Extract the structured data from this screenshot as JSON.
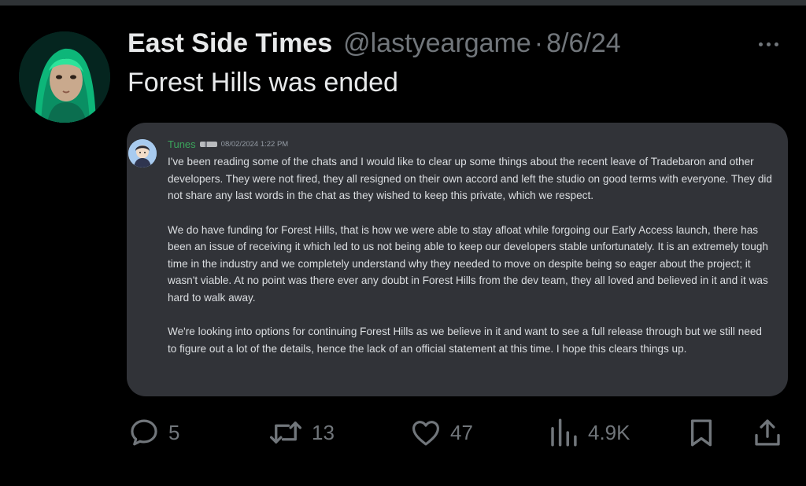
{
  "tweet": {
    "display_name": "East Side Times",
    "handle": "@lastyeargame",
    "separator": "·",
    "date": "8/6/24",
    "text": "Forest Hills was ended"
  },
  "message": {
    "author": "Tunes",
    "timestamp": "08/02/2024 1:22 PM",
    "paragraphs": [
      "I've been reading some of the chats and I would like to clear up some things about the recent leave of Tradebaron and other developers. They were not fired, they all resigned on their own accord and left the studio on good terms with everyone. They did not share any last words in the chat as they wished to keep this private, which we respect.",
      "We do have funding for Forest Hills, that is how we were able to stay afloat while forgoing our Early Access launch, there has been an issue of receiving it which led to us not being able to keep our developers stable unfortunately. It is an extremely tough time in the industry and we completely understand why they needed to move on despite being so eager about the project; it wasn't viable. At no point was there ever any doubt in Forest Hills from the dev team, they all loved and believed in it and it was hard to walk away.",
      "We're looking into options for continuing Forest Hills as we believe in it and want to see a full release through but we still need to figure out a lot of the details, hence the lack of an official statement at this time. I hope this clears things up."
    ]
  },
  "actions": {
    "replies": "5",
    "reposts": "13",
    "likes": "47",
    "views": "4.9K"
  },
  "icons": {
    "reply": "comment-bubble-icon",
    "repost": "repost-arrows-icon",
    "like": "heart-icon",
    "views": "bar-chart-icon",
    "bookmark": "bookmark-icon",
    "share": "share-upload-icon",
    "more": "more-dots-icon"
  },
  "colors": {
    "background": "#000000",
    "primary_text": "#e7e9ea",
    "secondary_text": "#71767b",
    "card_background": "#313338",
    "author_color": "#3ba55c",
    "message_text": "#dbdee1"
  }
}
